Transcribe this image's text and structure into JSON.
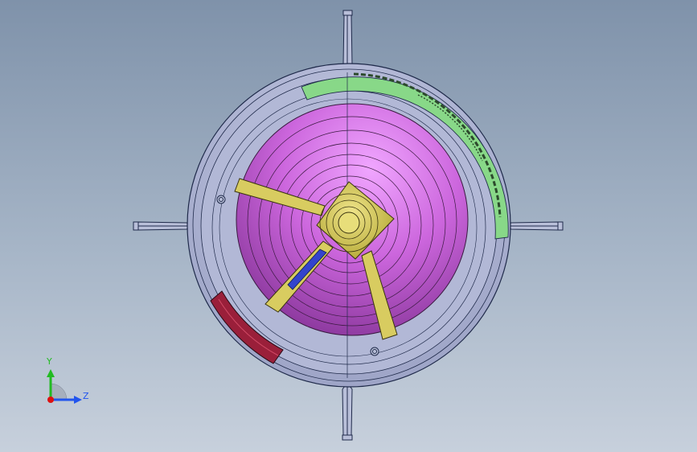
{
  "viewport": {
    "background_top": "#7f92aa",
    "background_bottom": "#c7d0dc"
  },
  "triad": {
    "y_label": "Y",
    "z_label": "Z",
    "y_color": "#22bb22",
    "z_color": "#2255ee",
    "x_color": "#dd1111"
  },
  "model": {
    "shell_color": "#b3b9d6",
    "inner_body_color": "#cc66dd",
    "core_color": "#d8cc60",
    "green_band_color": "#88d888",
    "red_band_color": "#9a1f3a",
    "blue_rod_color": "#3344cc",
    "outline_color": "#1f2a4a"
  }
}
